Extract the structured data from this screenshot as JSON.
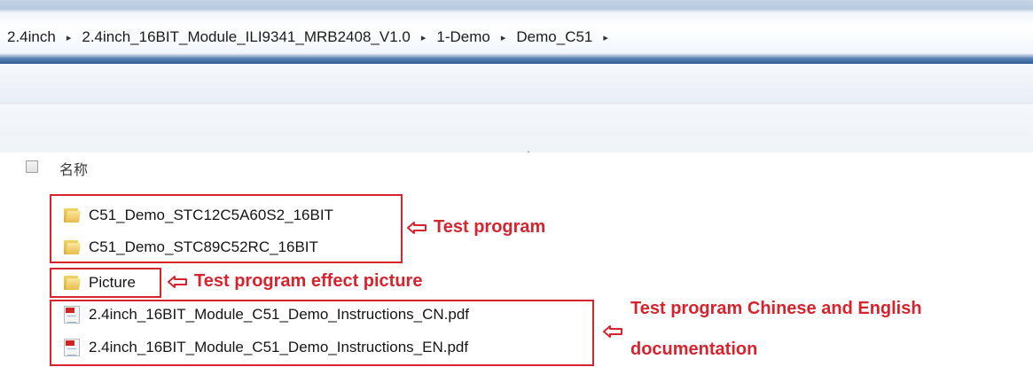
{
  "breadcrumb": {
    "items": [
      "2.4inch",
      "2.4inch_16BIT_Module_ILI9341_MRB2408_V1.0",
      "1-Demo",
      "Demo_C51"
    ],
    "separator": "▸"
  },
  "list_header": {
    "name_label": "名称"
  },
  "files": [
    {
      "name": "C51_Demo_STC12C5A60S2_16BIT",
      "icon": "folder-icon"
    },
    {
      "name": "C51_Demo_STC89C52RC_16BIT",
      "icon": "folder-icon"
    },
    {
      "name": "Picture",
      "icon": "folder-icon"
    },
    {
      "name": "2.4inch_16BIT_Module_C51_Demo_Instructions_CN.pdf",
      "icon": "pdf-icon"
    },
    {
      "name": "2.4inch_16BIT_Module_C51_Demo_Instructions_EN.pdf",
      "icon": "pdf-icon"
    }
  ],
  "annotations": {
    "test_program": "Test program",
    "effect_picture": "Test program effect picture",
    "docs_line1": "Test program Chinese and English",
    "docs_line2": "documentation"
  },
  "colors": {
    "annotation": "#d6242f",
    "address_bar_accent": "#2f5a94"
  }
}
